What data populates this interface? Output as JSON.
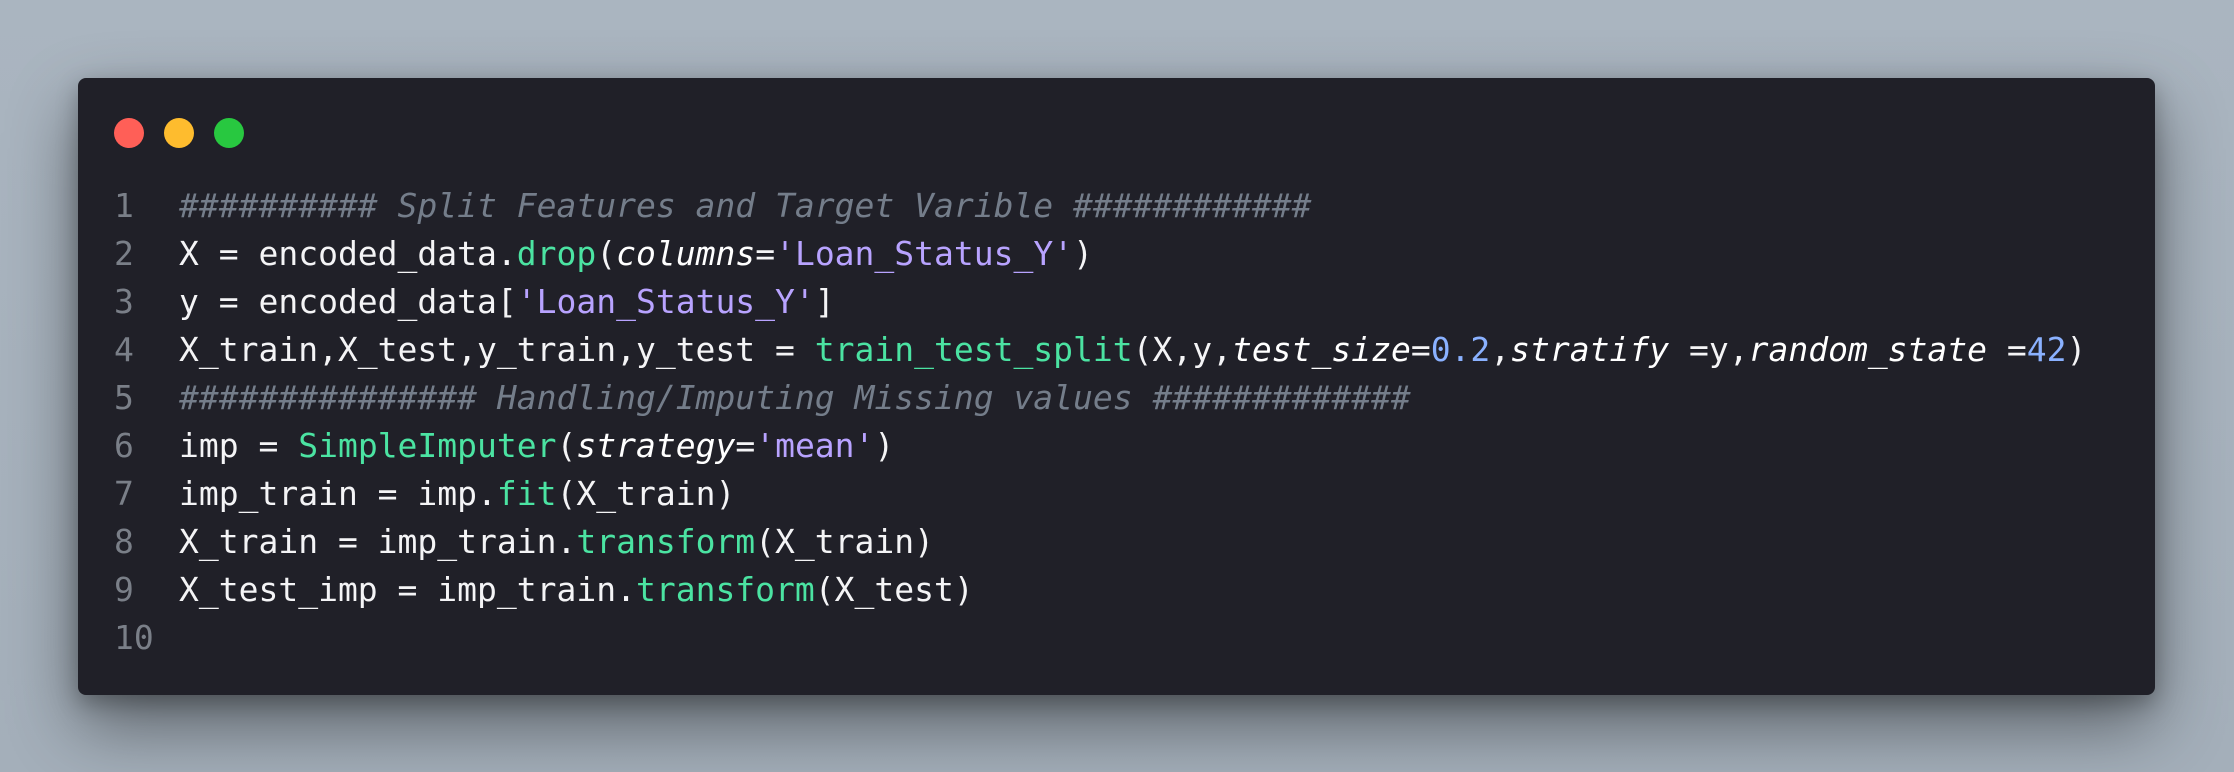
{
  "window": {
    "controls": [
      {
        "name": "close",
        "color": "#ff5f57"
      },
      {
        "name": "minimize",
        "color": "#febc2e"
      },
      {
        "name": "maximize",
        "color": "#28c840"
      }
    ]
  },
  "colors": {
    "comment": "#747d8a",
    "function": "#4be3a2",
    "string": "#b8a3ff",
    "number": "#8ab1ff",
    "plain": "#f4f4f6",
    "background": "#202028"
  },
  "code": {
    "lines": [
      {
        "n": "1",
        "tokens": [
          {
            "t": "########## Split Features and Target Varible ############",
            "c": "cm"
          }
        ]
      },
      {
        "n": "2",
        "tokens": [
          {
            "t": "X = encoded_data.",
            "c": "pl"
          },
          {
            "t": "drop",
            "c": "fn"
          },
          {
            "t": "(",
            "c": "pl"
          },
          {
            "t": "columns",
            "c": "kw"
          },
          {
            "t": "=",
            "c": "pl"
          },
          {
            "t": "'Loan_Status_Y'",
            "c": "st"
          },
          {
            "t": ")",
            "c": "pl"
          }
        ]
      },
      {
        "n": "3",
        "tokens": [
          {
            "t": "y = encoded_data[",
            "c": "pl"
          },
          {
            "t": "'Loan_Status_Y'",
            "c": "st"
          },
          {
            "t": "]",
            "c": "pl"
          }
        ]
      },
      {
        "n": "4",
        "tokens": [
          {
            "t": "X_train,X_test,y_train,y_test = ",
            "c": "pl"
          },
          {
            "t": "train_test_split",
            "c": "fn"
          },
          {
            "t": "(X,y,",
            "c": "pl"
          },
          {
            "t": "test_size",
            "c": "kw"
          },
          {
            "t": "=",
            "c": "pl"
          },
          {
            "t": "0.2",
            "c": "nu"
          },
          {
            "t": ",",
            "c": "pl"
          },
          {
            "t": "stratify",
            "c": "kw"
          },
          {
            "t": " =y,",
            "c": "pl"
          },
          {
            "t": "random_state",
            "c": "kw"
          },
          {
            "t": " =",
            "c": "pl"
          },
          {
            "t": "42",
            "c": "nu"
          },
          {
            "t": ")",
            "c": "pl"
          }
        ]
      },
      {
        "n": "5",
        "tokens": [
          {
            "t": "############### Handling/Imputing Missing values #############",
            "c": "cm"
          }
        ]
      },
      {
        "n": "6",
        "tokens": [
          {
            "t": "imp = ",
            "c": "pl"
          },
          {
            "t": "SimpleImputer",
            "c": "fn"
          },
          {
            "t": "(",
            "c": "pl"
          },
          {
            "t": "strategy",
            "c": "kw"
          },
          {
            "t": "=",
            "c": "pl"
          },
          {
            "t": "'mean'",
            "c": "st"
          },
          {
            "t": ")",
            "c": "pl"
          }
        ]
      },
      {
        "n": "7",
        "tokens": [
          {
            "t": "imp_train = imp.",
            "c": "pl"
          },
          {
            "t": "fit",
            "c": "fn"
          },
          {
            "t": "(X_train)",
            "c": "pl"
          }
        ]
      },
      {
        "n": "8",
        "tokens": [
          {
            "t": "X_train = imp_train.",
            "c": "pl"
          },
          {
            "t": "transform",
            "c": "fn"
          },
          {
            "t": "(X_train)",
            "c": "pl"
          }
        ]
      },
      {
        "n": "9",
        "tokens": [
          {
            "t": "X_test_imp = imp_train.",
            "c": "pl"
          },
          {
            "t": "transform",
            "c": "fn"
          },
          {
            "t": "(X_test)",
            "c": "pl"
          }
        ]
      },
      {
        "n": "10",
        "tokens": []
      }
    ]
  }
}
